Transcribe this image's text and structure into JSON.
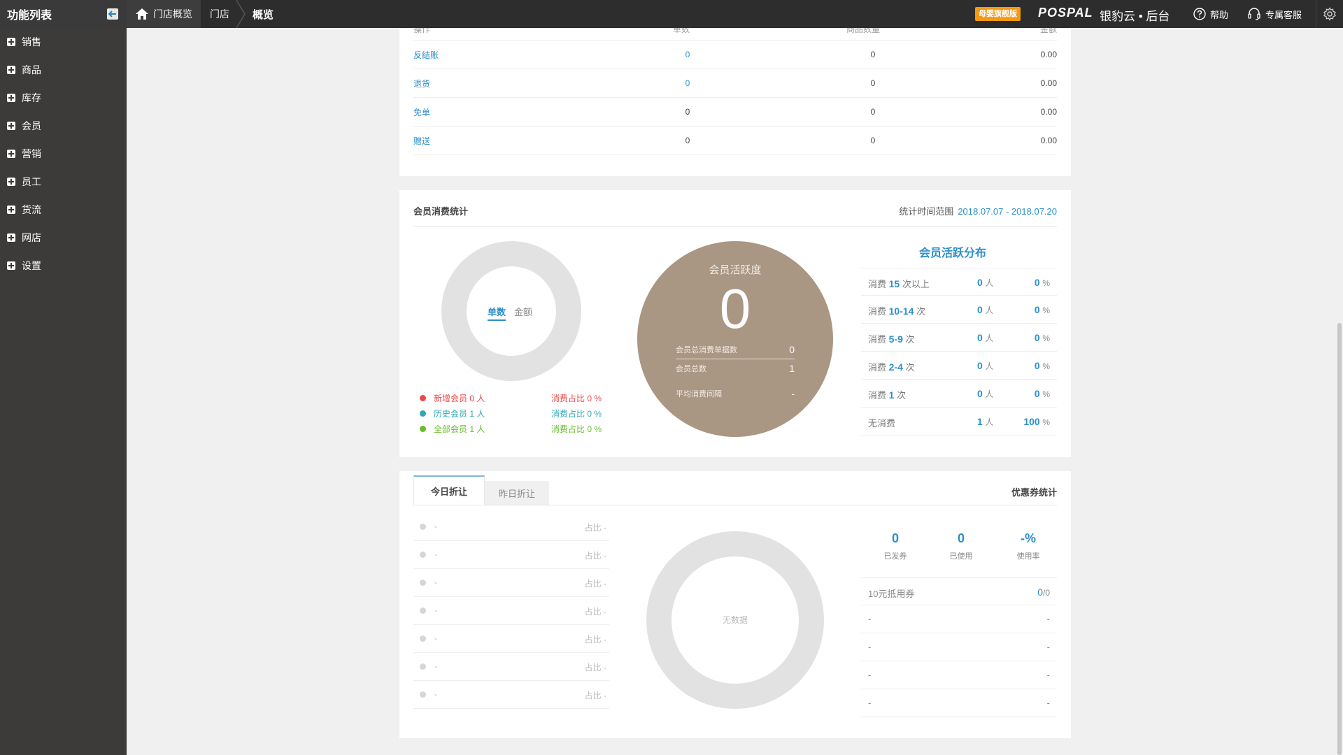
{
  "topbar": {
    "menu_title": "功能列表",
    "home_crumb": "门店概览",
    "store_crumb": "门店",
    "current_crumb": "概览",
    "badge": "母婴旗舰版",
    "logo": "POSPAL",
    "brand": "银豹云 • 后台",
    "help": "帮助",
    "service": "专属客服"
  },
  "sidebar": {
    "items": [
      {
        "label": "销售"
      },
      {
        "label": "商品"
      },
      {
        "label": "库存"
      },
      {
        "label": "会员"
      },
      {
        "label": "营销"
      },
      {
        "label": "员工"
      },
      {
        "label": "货流"
      },
      {
        "label": "网店"
      },
      {
        "label": "设置"
      }
    ]
  },
  "ops_table": {
    "headers": [
      "操作",
      "单数",
      "商品数量",
      "金额"
    ],
    "rows": [
      {
        "name": "反结账",
        "count": "0",
        "qty": "0",
        "amount": "0.00"
      },
      {
        "name": "退货",
        "count": "0",
        "qty": "0",
        "amount": "0.00"
      },
      {
        "name": "免单",
        "count": "0",
        "qty": "0",
        "amount": "0.00"
      },
      {
        "name": "赠送",
        "count": "0",
        "qty": "0",
        "amount": "0.00"
      }
    ]
  },
  "member_stats": {
    "title": "会员消费统计",
    "range_label": "统计时间范围",
    "range_value": "2018.07.07 - 2018.07.20",
    "ring_tabs": [
      "单数",
      "金额"
    ],
    "legend": [
      {
        "label": "新增会员 0 人",
        "share": "消费占比 0 %",
        "color": "#e8494b"
      },
      {
        "label": "历史会员 1 人",
        "share": "消费占比 0 %",
        "color": "#2ea7b6"
      },
      {
        "label": "全部会员 1 人",
        "share": "消费占比 0 %",
        "color": "#68bc2c"
      }
    ],
    "activity": {
      "title": "会员活跃度",
      "value": "0",
      "rows": [
        {
          "label": "会员总消费单据数",
          "value": "0"
        },
        {
          "label": "会员总数",
          "value": "1"
        },
        {
          "label": "平均消费间隔",
          "value": "-"
        }
      ]
    },
    "distribution": {
      "title": "会员活跃分布",
      "rows": [
        {
          "pre": "消费",
          "num": "15",
          "post": "次以上",
          "people": "0",
          "people_unit": "人",
          "pct": "0",
          "pct_unit": "%"
        },
        {
          "pre": "消费",
          "num": "10-14",
          "post": "次",
          "people": "0",
          "people_unit": "人",
          "pct": "0",
          "pct_unit": "%"
        },
        {
          "pre": "消费",
          "num": "5-9",
          "post": "次",
          "people": "0",
          "people_unit": "人",
          "pct": "0",
          "pct_unit": "%"
        },
        {
          "pre": "消费",
          "num": "2-4",
          "post": "次",
          "people": "0",
          "people_unit": "人",
          "pct": "0",
          "pct_unit": "%"
        },
        {
          "pre": "消费",
          "num": "1",
          "post": "次",
          "people": "0",
          "people_unit": "人",
          "pct": "0",
          "pct_unit": "%"
        },
        {
          "pre": "无消费",
          "num": "",
          "post": "",
          "people": "1",
          "people_unit": "人",
          "pct": "100",
          "pct_unit": "%"
        }
      ]
    }
  },
  "discount": {
    "tabs": [
      "今日折让",
      "昨日折让"
    ],
    "coupon_title": "优惠券统计",
    "rows": [
      {
        "name": "-",
        "share": "占比 -"
      },
      {
        "name": "-",
        "share": "占比 -"
      },
      {
        "name": "-",
        "share": "占比 -"
      },
      {
        "name": "-",
        "share": "占比 -"
      },
      {
        "name": "-",
        "share": "占比 -"
      },
      {
        "name": "-",
        "share": "占比 -"
      },
      {
        "name": "-",
        "share": "占比 -"
      }
    ],
    "ring_empty": "无数据",
    "coupon_stats": [
      {
        "value": "0",
        "label": "已发券"
      },
      {
        "value": "0",
        "label": "已使用"
      },
      {
        "value": "-%",
        "label": "使用率"
      }
    ],
    "coupons": [
      {
        "name": "10元抵用券",
        "used": "0",
        "total": "/0"
      },
      {
        "name": "-",
        "used": "-",
        "total": ""
      },
      {
        "name": "-",
        "used": "-",
        "total": ""
      },
      {
        "name": "-",
        "used": "-",
        "total": ""
      },
      {
        "name": "-",
        "used": "-",
        "total": ""
      }
    ]
  }
}
